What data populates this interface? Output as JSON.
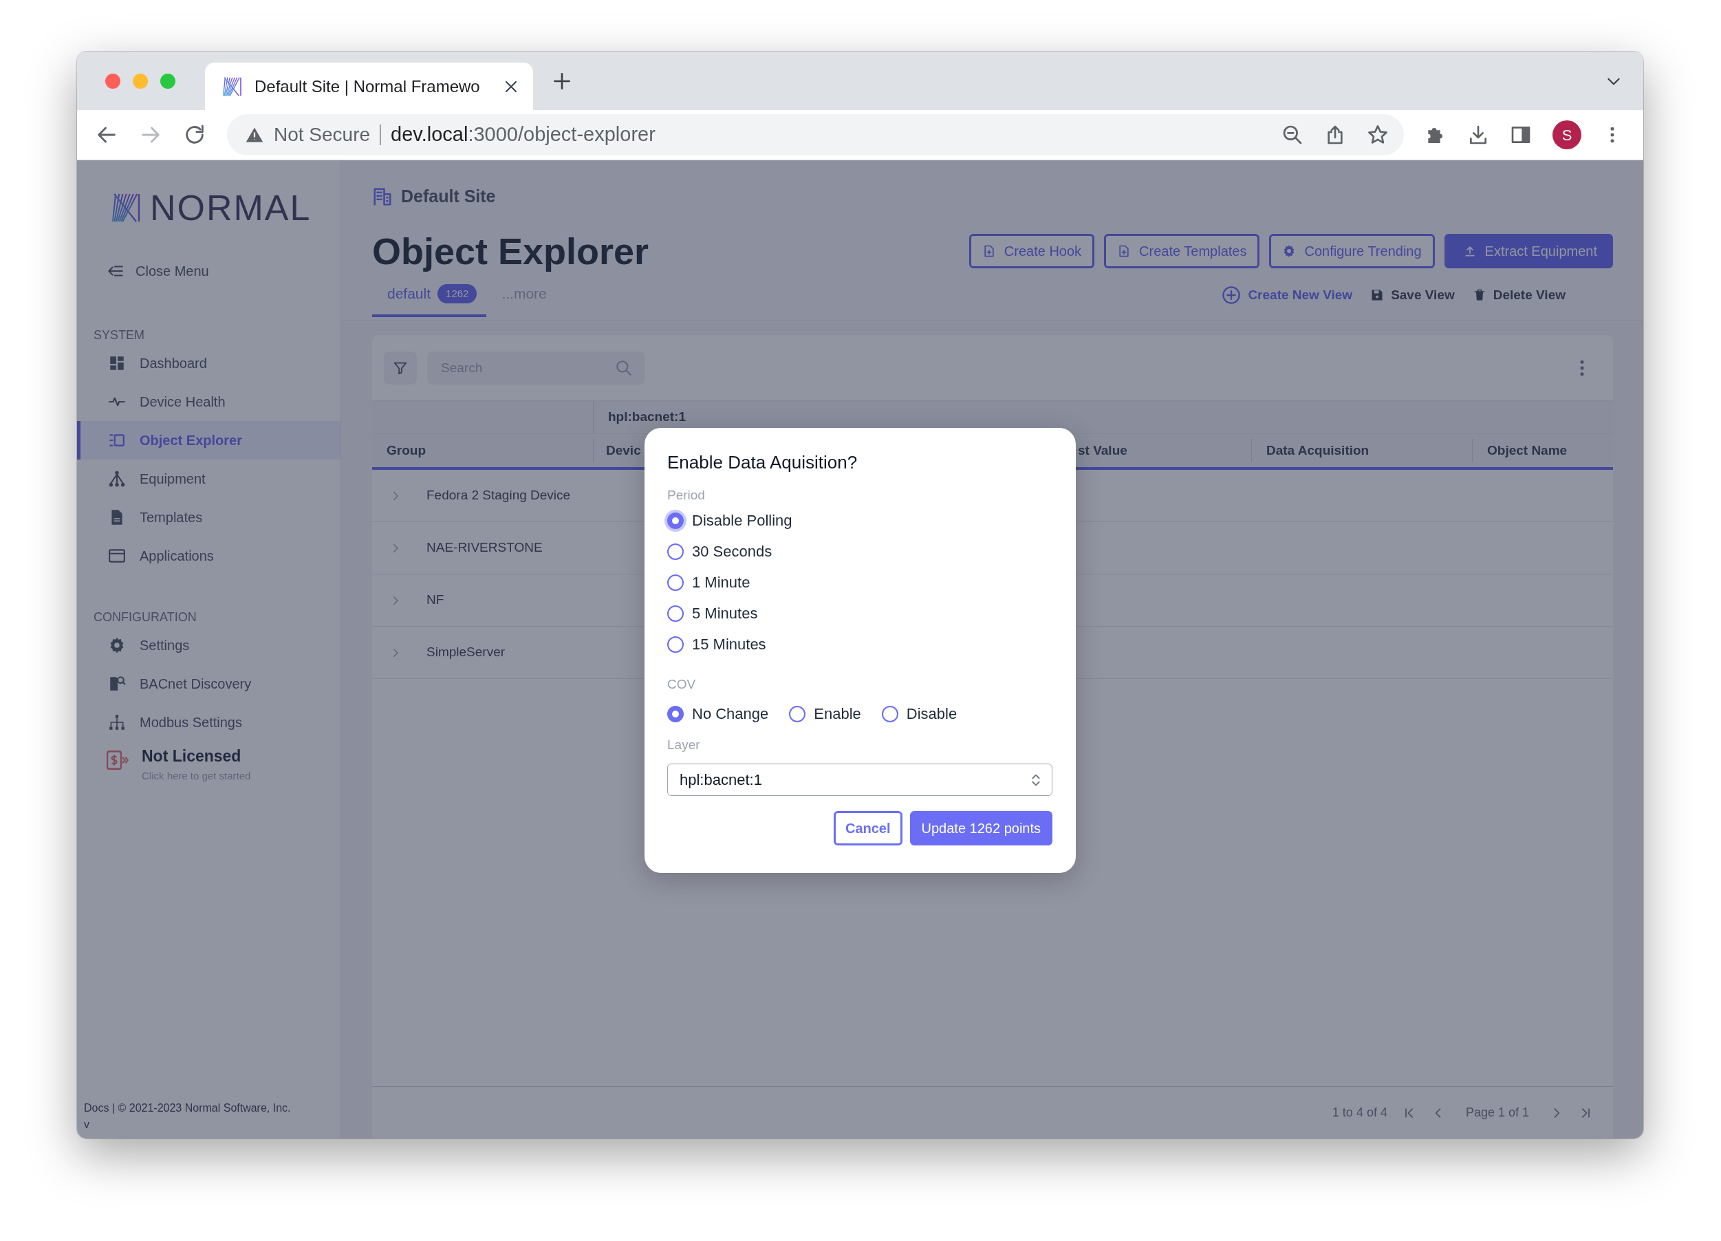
{
  "browser": {
    "tab_title": "Default Site | Normal Framewo",
    "security": "Not Secure",
    "url_host": "dev.local",
    "url_path": ":3000/object-explorer",
    "profile_initial": "S"
  },
  "sidebar": {
    "logo": "NORMAL",
    "close_menu": "Close Menu",
    "sections": [
      {
        "heading": "SYSTEM",
        "items": [
          {
            "label": "Dashboard",
            "selected": false
          },
          {
            "label": "Device Health",
            "selected": false
          },
          {
            "label": "Object Explorer",
            "selected": true
          },
          {
            "label": "Equipment",
            "selected": false
          },
          {
            "label": "Templates",
            "selected": false
          },
          {
            "label": "Applications",
            "selected": false
          }
        ]
      },
      {
        "heading": "CONFIGURATION",
        "items": [
          {
            "label": "Settings",
            "selected": false
          },
          {
            "label": "BACnet Discovery",
            "selected": false
          },
          {
            "label": "Modbus Settings",
            "selected": false
          }
        ]
      }
    ],
    "license": {
      "title": "Not Licensed",
      "subtitle": "Click here to get started"
    },
    "footer": "Docs | © 2021-2023 Normal Software, Inc.",
    "footer_version": "v"
  },
  "header": {
    "breadcrumb": "Default Site",
    "title": "Object Explorer",
    "actions": [
      {
        "label": "Create Hook",
        "kind": "outline"
      },
      {
        "label": "Create Templates",
        "kind": "outline"
      },
      {
        "label": "Configure Trending",
        "kind": "outline"
      },
      {
        "label": "Extract Equipment",
        "kind": "primary"
      }
    ],
    "view_tabs": [
      {
        "label": "default",
        "count": "1262",
        "selected": true
      },
      {
        "label": "...more",
        "selected": false
      }
    ],
    "view_actions": [
      {
        "label": "Create New View",
        "kind": "link"
      },
      {
        "label": "Save View",
        "kind": "plain"
      },
      {
        "label": "Delete View",
        "kind": "plain"
      }
    ]
  },
  "table": {
    "search": {
      "placeholder": "Search"
    },
    "group_header": "hpl:bacnet:1",
    "columns": [
      "Group",
      "Devic",
      "st Value",
      "Data Acquisition",
      "Object Name"
    ],
    "rows": [
      {
        "group": "Fedora 2 Staging Device",
        "expanded": false
      },
      {
        "group": "NAE-RIVERSTONE",
        "expanded": false
      },
      {
        "group": "NF",
        "expanded": false
      },
      {
        "group": "SimpleServer",
        "expanded": false
      }
    ]
  },
  "pagination": {
    "range": "1 to 4 of 4",
    "page": "Page 1 of 1"
  },
  "modal": {
    "title": "Enable Data Aquisition?",
    "period_label": "Period",
    "periods": [
      {
        "label": "Disable Polling",
        "selected": true,
        "focused": true
      },
      {
        "label": "30 Seconds",
        "selected": false,
        "focused": false
      },
      {
        "label": "1 Minute",
        "selected": false,
        "focused": false
      },
      {
        "label": "5 Minutes",
        "selected": false,
        "focused": false
      },
      {
        "label": "15 Minutes",
        "selected": false,
        "focused": false
      }
    ],
    "cov_label": "COV",
    "cov_options": [
      {
        "label": "No Change",
        "selected": true
      },
      {
        "label": "Enable",
        "selected": false
      },
      {
        "label": "Disable",
        "selected": false
      }
    ],
    "layer_label": "Layer",
    "layer_value": "hpl:bacnet:1",
    "buttons": [
      {
        "label": "Cancel",
        "kind": "outline"
      },
      {
        "label": "Update 1262 points",
        "kind": "primary"
      }
    ]
  }
}
